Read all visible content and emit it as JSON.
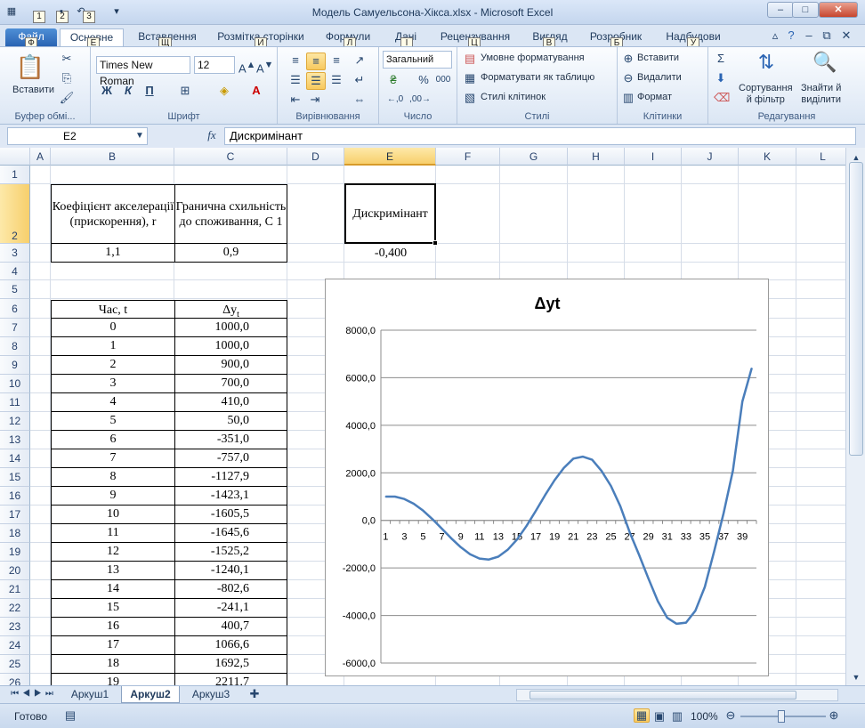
{
  "window": {
    "title": "Модель Самуельсона-Хікса.xlsx  -  Microsoft Excel",
    "min": "–",
    "max": "□",
    "close": "✕"
  },
  "quick_access_keytips": [
    "1",
    "2",
    "3"
  ],
  "tabs": [
    {
      "label": "Файл",
      "keytip": "Ф"
    },
    {
      "label": "Основне",
      "keytip": "Е"
    },
    {
      "label": "Вставлення",
      "keytip": "Щ"
    },
    {
      "label": "Розмітка сторінки",
      "keytip": "И"
    },
    {
      "label": "Формули",
      "keytip": "Л"
    },
    {
      "label": "Дані",
      "keytip": "І"
    },
    {
      "label": "Рецензування",
      "keytip": "Ц"
    },
    {
      "label": "Вигляд",
      "keytip": "В"
    },
    {
      "label": "Розробник",
      "keytip": "Б"
    },
    {
      "label": "Надбудови",
      "keytip": "У"
    }
  ],
  "ribbon": {
    "clipboard": {
      "paste": "Вставити",
      "label": "Буфер обмі..."
    },
    "font": {
      "name": "Times New Roman",
      "size": "12",
      "bold": "Ж",
      "italic": "К",
      "underline": "П",
      "label": "Шрифт"
    },
    "alignment": {
      "label": "Вирівнювання"
    },
    "number": {
      "format": "Загальний",
      "percent": "%",
      "thousands": "000",
      "label": "Число"
    },
    "styles": {
      "conditional": "Умовне форматування",
      "as_table": "Форматувати як таблицю",
      "cell_styles": "Стилі клітинок",
      "label": "Стилі"
    },
    "cells": {
      "insert": "Вставити",
      "delete": "Видалити",
      "format": "Формат",
      "label": "Клітинки"
    },
    "editing": {
      "sigma": "Σ",
      "sort": "Сортування\nй фільтр",
      "find": "Знайти й\nвиділити",
      "label": "Редагування"
    }
  },
  "formula_bar": {
    "name_box": "E2",
    "fx": "fx",
    "content": "Дискримінант"
  },
  "columns": [
    "A",
    "B",
    "C",
    "D",
    "E",
    "F",
    "G",
    "H",
    "I",
    "J",
    "K",
    "L"
  ],
  "rows": [
    "1",
    "2",
    "3",
    "4",
    "5",
    "6",
    "7",
    "8",
    "9",
    "10",
    "11",
    "12",
    "13",
    "14",
    "15",
    "16",
    "17",
    "18",
    "19",
    "20",
    "21",
    "22",
    "23",
    "24",
    "25",
    "26"
  ],
  "params": {
    "r_header": "Коефіцієнт акселерації (прискорення), r",
    "c_header": "Гранична схильність до споживання, C 1",
    "r_value": "1,1",
    "c_value": "0,9",
    "disc_header": "Дискримінант",
    "disc_value": "-0,400"
  },
  "table": {
    "col1_header": "Час, t",
    "col2_header": "Δy",
    "col2_sub": "t",
    "rows": [
      [
        "0",
        "1000,0"
      ],
      [
        "1",
        "1000,0"
      ],
      [
        "2",
        "900,0"
      ],
      [
        "3",
        "700,0"
      ],
      [
        "4",
        "410,0"
      ],
      [
        "5",
        "50,0"
      ],
      [
        "6",
        "-351,0"
      ],
      [
        "7",
        "-757,0"
      ],
      [
        "8",
        "-1127,9"
      ],
      [
        "9",
        "-1423,1"
      ],
      [
        "10",
        "-1605,5"
      ],
      [
        "11",
        "-1645,6"
      ],
      [
        "12",
        "-1525,2"
      ],
      [
        "13",
        "-1240,1"
      ],
      [
        "14",
        "-802,6"
      ],
      [
        "15",
        "-241,1"
      ],
      [
        "16",
        "400,7"
      ],
      [
        "17",
        "1066,6"
      ],
      [
        "18",
        "1692,5"
      ],
      [
        "19",
        "2211,7"
      ]
    ]
  },
  "chart_data": {
    "type": "line",
    "title": "Δyt",
    "ylim": [
      -6000,
      8000
    ],
    "yticks": [
      "8000,0",
      "6000,0",
      "4000,0",
      "2000,0",
      "0,0",
      "-2000,0",
      "-4000,0",
      "-6000,0"
    ],
    "xtick_labels": [
      "1",
      "3",
      "5",
      "7",
      "9",
      "11",
      "13",
      "15",
      "17",
      "19",
      "21",
      "23",
      "25",
      "27",
      "29",
      "31",
      "33",
      "35",
      "37",
      "39"
    ],
    "x": [
      1,
      2,
      3,
      4,
      5,
      6,
      7,
      8,
      9,
      10,
      11,
      12,
      13,
      14,
      15,
      16,
      17,
      18,
      19,
      20,
      21,
      22,
      23,
      24,
      25,
      26,
      27,
      28,
      29,
      30,
      31,
      32,
      33,
      34,
      35,
      36,
      37,
      38,
      39,
      40
    ],
    "values": [
      1000,
      1000,
      900,
      700,
      410,
      50,
      -351,
      -757,
      -1127.9,
      -1423.1,
      -1605.5,
      -1645.6,
      -1525.2,
      -1240.1,
      -802.6,
      -241.1,
      400.7,
      1066.6,
      1692.5,
      2211.7,
      2600,
      2680,
      2550,
      2080,
      1450,
      600,
      -500,
      -1450,
      -2450,
      -3400,
      -4100,
      -4350,
      -4300,
      -3800,
      -2800,
      -1300,
      300,
      2100,
      5000,
      6400
    ],
    "color": "#4a7ebb",
    "grid": true
  },
  "sheets": [
    "Аркуш1",
    "Аркуш2",
    "Аркуш3"
  ],
  "active_sheet": "Аркуш2",
  "status": {
    "ready": "Готово",
    "zoom": "100%"
  }
}
